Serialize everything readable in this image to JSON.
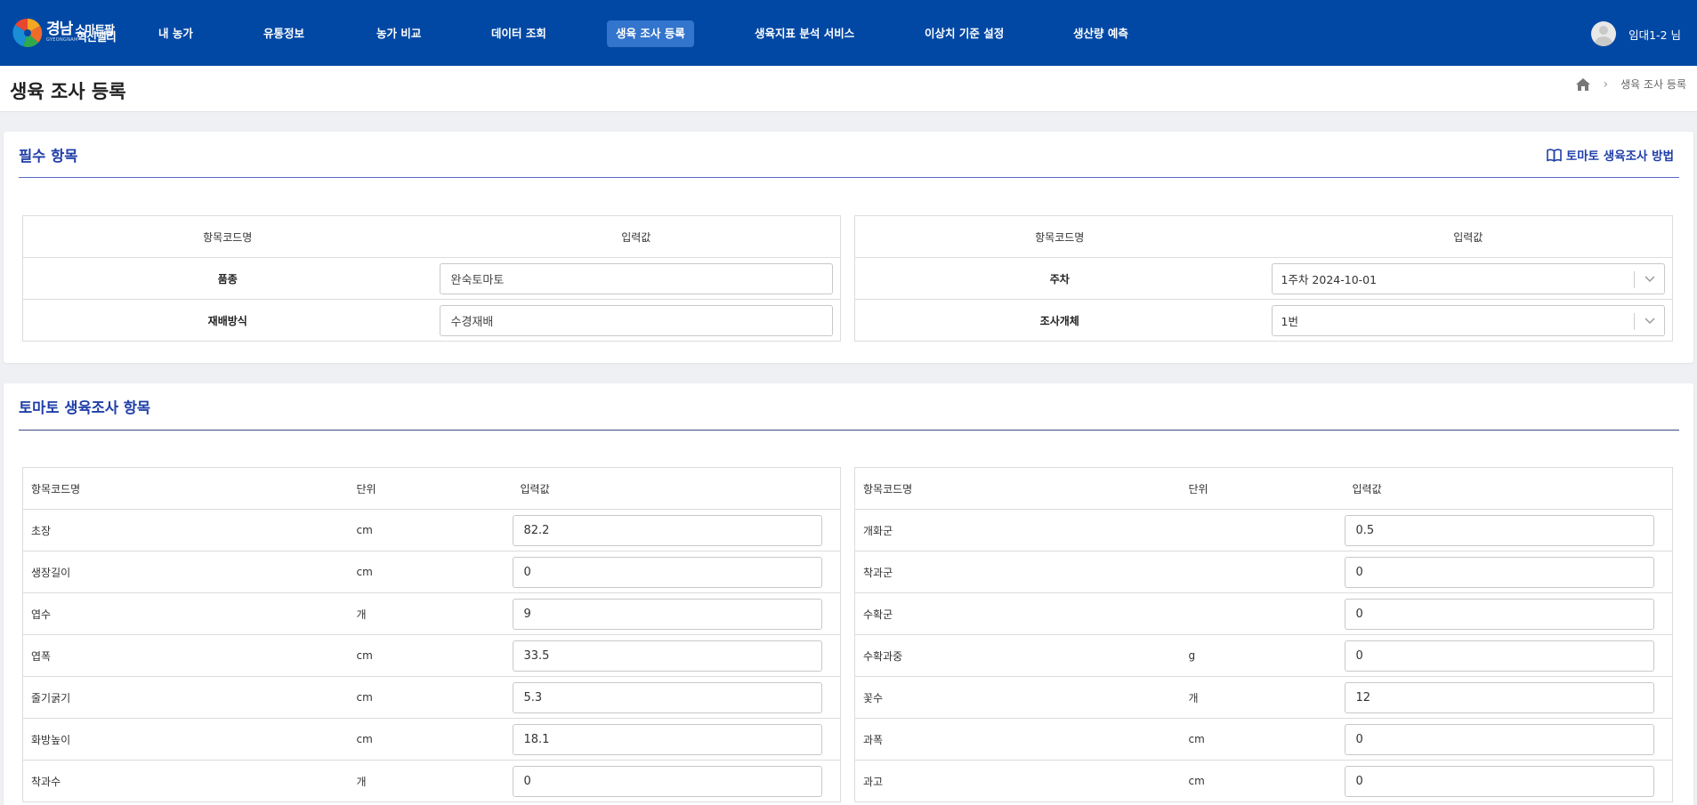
{
  "brand": {
    "logo_main": "경남",
    "logo_small": "스마트팜",
    "logo_sub": "GYEONGNAM",
    "logo_line2": "혁신밸리",
    "colors": {
      "nav_bg": "#0148a4",
      "nav_active": "#3375cc",
      "accent": "#1f3ea8"
    }
  },
  "nav": {
    "items": [
      {
        "label": "내 농가"
      },
      {
        "label": "유통정보"
      },
      {
        "label": "농가 비교"
      },
      {
        "label": "데이터 조회"
      },
      {
        "label": "생육 조사 등록",
        "active": true
      },
      {
        "label": "생육지표 분석 서비스"
      },
      {
        "label": "이상치 기준 설정"
      },
      {
        "label": "생산량 예측"
      }
    ],
    "user_name": "임대1-2 님"
  },
  "page": {
    "title": "생육 조사 등록",
    "breadcrumb": "생육 조사 등록"
  },
  "required": {
    "title": "필수 항목",
    "guide_link": "토마토 생육조사 방법",
    "col_name": "항목코드명",
    "col_value": "입력값",
    "left": [
      {
        "label": "품종",
        "value": "완숙토마토"
      },
      {
        "label": "재배방식",
        "value": "수경재배"
      }
    ],
    "right": [
      {
        "label": "주차",
        "value": "1주차 2024-10-01"
      },
      {
        "label": "조사개체",
        "value": "1번"
      }
    ]
  },
  "growth": {
    "title": "토마토 생육조사 항목",
    "col_name": "항목코드명",
    "col_unit": "단위",
    "col_value": "입력값",
    "left": [
      {
        "name": "초장",
        "unit": "cm",
        "value": "82.2"
      },
      {
        "name": "생장길이",
        "unit": "cm",
        "value": "0"
      },
      {
        "name": "엽수",
        "unit": "개",
        "value": "9"
      },
      {
        "name": "엽폭",
        "unit": "cm",
        "value": "33.5"
      },
      {
        "name": "줄기굵기",
        "unit": "cm",
        "value": "5.3"
      },
      {
        "name": "화방높이",
        "unit": "cm",
        "value": "18.1"
      },
      {
        "name": "착과수",
        "unit": "개",
        "value": "0"
      }
    ],
    "right": [
      {
        "name": "개화군",
        "unit": "",
        "value": "0.5"
      },
      {
        "name": "착과군",
        "unit": "",
        "value": "0"
      },
      {
        "name": "수확군",
        "unit": "",
        "value": "0"
      },
      {
        "name": "수확과중",
        "unit": "g",
        "value": "0"
      },
      {
        "name": "꽃수",
        "unit": "개",
        "value": "12"
      },
      {
        "name": "과폭",
        "unit": "cm",
        "value": "0"
      },
      {
        "name": "과고",
        "unit": "cm",
        "value": "0"
      }
    ]
  }
}
